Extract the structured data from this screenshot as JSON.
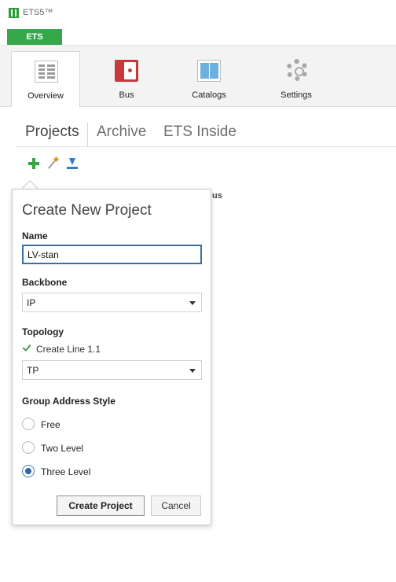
{
  "app": {
    "title": "ETS5™",
    "main_tab": "ETS"
  },
  "ribbon": {
    "tabs": [
      {
        "label": "Overview",
        "icon": "overview-icon",
        "active": true
      },
      {
        "label": "Bus",
        "icon": "bus-icon"
      },
      {
        "label": "Catalogs",
        "icon": "catalogs-icon"
      },
      {
        "label": "Settings",
        "icon": "settings-gear-icon"
      }
    ]
  },
  "project_tabs": [
    "Projects",
    "Archive",
    "ETS Inside"
  ],
  "toolbar": {
    "icons": [
      "add-project-icon",
      "wizard-wand-icon",
      "import-icon"
    ]
  },
  "background_text": "us",
  "popup": {
    "title": "Create New Project",
    "name": {
      "label": "Name",
      "value": "LV-stan"
    },
    "backbone": {
      "label": "Backbone",
      "value": "IP"
    },
    "topology": {
      "label": "Topology",
      "checkbox_label": "Create Line 1.1",
      "checked": true,
      "medium": "TP"
    },
    "group_address": {
      "label": "Group Address Style",
      "options": [
        "Free",
        "Two Level",
        "Three Level"
      ],
      "selected": "Three Level"
    },
    "buttons": {
      "create": "Create Project",
      "cancel": "Cancel"
    }
  },
  "colors": {
    "brand_green": "#36a84b",
    "focus_blue": "#3a6fa0",
    "radio_selected": "#2f66a5"
  }
}
